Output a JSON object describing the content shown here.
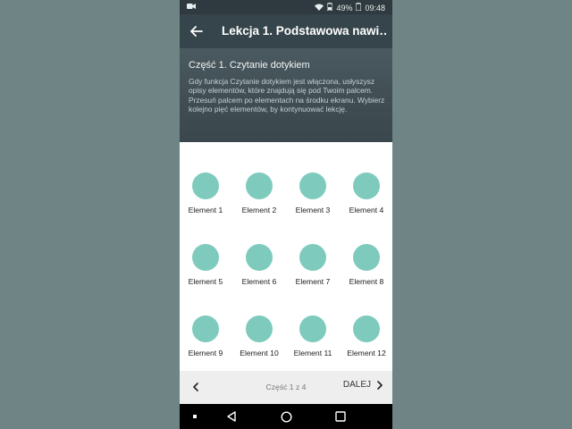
{
  "status": {
    "battery_percent": "49%",
    "time": "09:48"
  },
  "appbar": {
    "title": "Lekcja 1. Podstawowa nawi…"
  },
  "intro": {
    "title": "Część 1. Czytanie dotykiem",
    "text": "Gdy funkcja Czytanie dotykiem jest włączona, usłyszysz opisy elementów, które znajdują się pod Twoim palcem. Przesuń palcem po elementach na środku ekranu. Wybierz kolejno pięć elementów, by kontynuować lekcję."
  },
  "grid": {
    "items": [
      {
        "label": "Element 1"
      },
      {
        "label": "Element 2"
      },
      {
        "label": "Element 3"
      },
      {
        "label": "Element 4"
      },
      {
        "label": "Element 5"
      },
      {
        "label": "Element 6"
      },
      {
        "label": "Element 7"
      },
      {
        "label": "Element 8"
      },
      {
        "label": "Element 9"
      },
      {
        "label": "Element 10"
      },
      {
        "label": "Element 11"
      },
      {
        "label": "Element 12"
      }
    ]
  },
  "nav": {
    "page_indicator": "Część 1 z 4",
    "next_label": "DALEJ"
  },
  "colors": {
    "accent_dot": "#7ecbbd",
    "appbar": "#36454b",
    "statusbar": "#2e3a3f",
    "background": "#6f8485"
  },
  "icons": [
    "video-camera-icon",
    "wifi-icon",
    "battery-icon",
    "back-arrow-icon",
    "chevron-left-icon",
    "chevron-right-icon",
    "system-back-icon",
    "system-home-icon",
    "system-recents-icon"
  ]
}
